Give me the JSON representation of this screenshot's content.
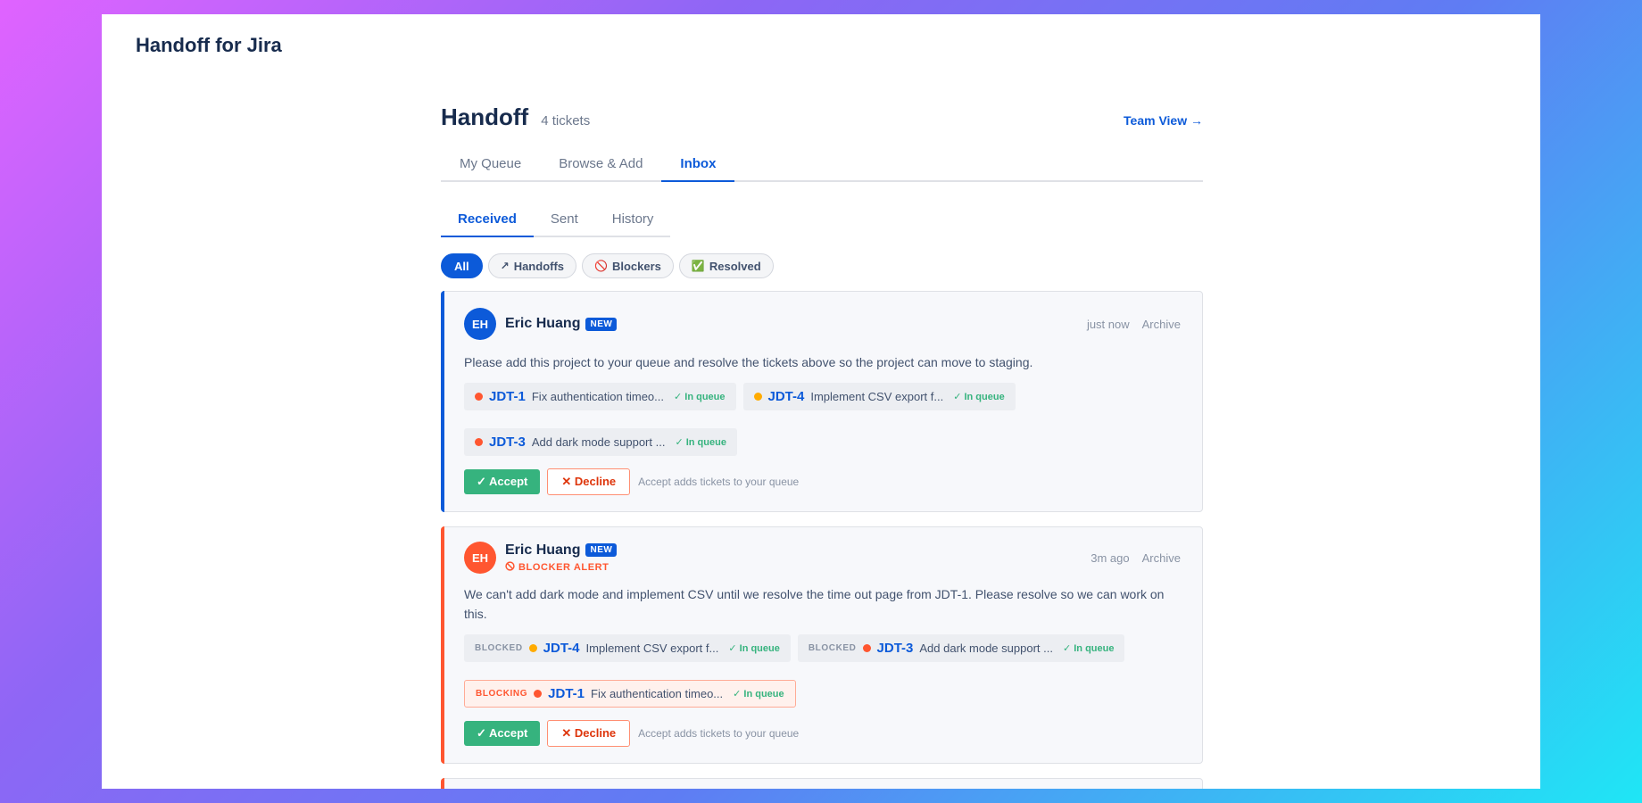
{
  "app": {
    "title": "Handoff for Jira"
  },
  "header": {
    "title": "Handoff",
    "count": "4 tickets",
    "team_link": "Team View →"
  },
  "tabs": [
    {
      "label": "My Queue"
    },
    {
      "label": "Browse & Add"
    },
    {
      "label": "Inbox"
    }
  ],
  "subtabs": [
    {
      "label": "Received"
    },
    {
      "label": "Sent"
    },
    {
      "label": "History"
    }
  ],
  "filters": [
    {
      "label": "All",
      "icon": ""
    },
    {
      "label": "Handoffs",
      "icon": "↗"
    },
    {
      "label": "Blockers",
      "icon": "🚫"
    },
    {
      "label": "Resolved",
      "icon": "✅"
    }
  ],
  "colors": {
    "accent": "#0c5ad9",
    "blocker": "#ff5630",
    "success": "#36b37e",
    "priority_high": "#ff5630",
    "priority_medium": "#ffab00"
  },
  "cards": [
    {
      "initials": "EH",
      "sender": "Eric Huang",
      "badge": "NEW",
      "time": "just now",
      "archive": "Archive",
      "message": "Please add this project to your queue and resolve the tickets above so the project can move to staging.",
      "tickets": [
        {
          "key": "JDT-1",
          "summary": "Fix authentication timeo...",
          "status": "✓ In queue",
          "priority": "high"
        },
        {
          "key": "JDT-4",
          "summary": "Implement CSV export f...",
          "status": "✓ In queue",
          "priority": "medium"
        },
        {
          "key": "JDT-3",
          "summary": "Add dark mode support ...",
          "status": "✓ In queue",
          "priority": "high"
        }
      ],
      "accept": "✓ Accept",
      "decline": "✕ Decline",
      "hint": "Accept adds tickets to your queue"
    },
    {
      "initials": "EH",
      "sender": "Eric Huang",
      "badge": "NEW",
      "alert": "BLOCKER ALERT",
      "time": "3m ago",
      "archive": "Archive",
      "message": "We can't add dark mode and implement CSV until we resolve the time out page from JDT-1. Please resolve so we can work on this.",
      "tickets": [
        {
          "relation": "BLOCKED",
          "key": "JDT-4",
          "summary": "Implement CSV export f...",
          "status": "✓ In queue",
          "priority": "medium"
        },
        {
          "relation": "BLOCKED",
          "key": "JDT-3",
          "summary": "Add dark mode support ...",
          "status": "✓ In queue",
          "priority": "high"
        },
        {
          "relation": "BLOCKING",
          "key": "JDT-1",
          "summary": "Fix authentication timeo...",
          "status": "✓ In queue",
          "priority": "high"
        }
      ],
      "accept": "✓ Accept",
      "decline": "✕ Decline",
      "hint": "Accept adds tickets to your queue"
    }
  ]
}
